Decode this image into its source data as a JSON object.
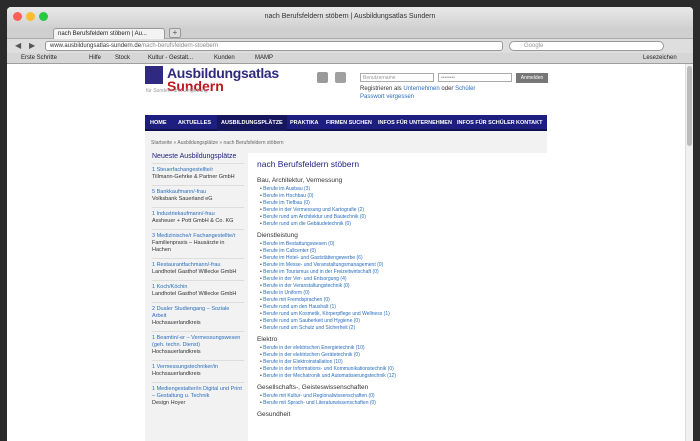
{
  "browser": {
    "window_title": "nach Berufsfeldern stöbern | Ausbildungsatlas Sundern",
    "tab_title": "nach Berufsfeldern stöbern | Au...",
    "url_domain": "www.ausbildungsatlas-sundern.de",
    "url_path": "/nach-berufsfeldern-stoebern",
    "search_placeholder": "Google",
    "bookmarks": [
      "Erste Schritte",
      "Hilfe",
      "Stock",
      "Kultur - Gestalt...",
      "Kunden",
      "MAMP"
    ],
    "reading_list": "Lesezeichen"
  },
  "site": {
    "logo_line1": "Ausbildungsatlas",
    "logo_line2": "Sundern",
    "tagline": "für Sundern und Umgebung",
    "login": {
      "user_placeholder": "Benutzername",
      "pass_placeholder": "••••••••",
      "button": "Anmelden",
      "register_prefix": "Registrieren als",
      "register_company": "Unternehmen",
      "register_or": "oder",
      "register_student": "Schüler",
      "forgot": "Passwort vergessen"
    },
    "nav": [
      "HOME",
      "AKTUELLES",
      "AUSBILDUNGSPLÄTZE",
      "PRAKTIKA",
      "FIRMEN SUCHEN",
      "INFOS FÜR UNTERNEHMEN",
      "INFOS FÜR SCHÜLER",
      "KONTAKT"
    ],
    "breadcrumb": "Startseite » Ausbildungsplätze » nach Berufsfeldern stöbern",
    "sidebar_title": "Neueste Ausbildungsplätze",
    "jobs": [
      {
        "title": "1 Steuerfachangestellte/r",
        "company": "Tillmann-Gehrke & Partner GmbH"
      },
      {
        "title": "5 Bankkaufmann/-frau",
        "company": "Volksbank Sauerland eG"
      },
      {
        "title": "1 Industriekaufmann/-frau",
        "company": "Assheuer + Pott GmbH & Co. KG"
      },
      {
        "title": "3 Medizinische/r Fachangestellte/r",
        "company": "Familienpraxis – Hausärzte in Hachen"
      },
      {
        "title": "1 Restaurantfachmann/-frau",
        "company": "Landhotel Gasthof Willecke GmbH"
      },
      {
        "title": "1 Koch/Köchin",
        "company": "Landhotel Gasthof Willecke GmbH"
      },
      {
        "title": "2 Dualer Studiengang – Soziale Arbeit",
        "company": "Hochsauerlandkreis"
      },
      {
        "title": "1 Beamtin/-er – Vermessungswesen (geh. techn. Dienst)",
        "company": "Hochsauerlandkreis"
      },
      {
        "title": "1 Vermessungstechniker/in",
        "company": "Hochsauerlandkreis"
      },
      {
        "title": "1 Mediengestalter/in Digital und Print – Gestaltung u. Technik",
        "company": "Design Hoyer"
      }
    ],
    "main_title": "nach Berufsfeldern stöbern",
    "categories": [
      {
        "name": "Bau, Architektur, Vermessung",
        "items": [
          "Berufe im Ausbau (3)",
          "Berufe im Hochbau (0)",
          "Berufe im Tiefbau (0)",
          "Berufe in der Vermessung und Kartografie (2)",
          "Berufe rund um Architektur und Bautechnik (0)",
          "Berufe rund um die Gebäudetechnik (0)"
        ]
      },
      {
        "name": "Dienstleistung",
        "items": [
          "Berufe im Bestattungswesen (0)",
          "Berufe im Callcenter (0)",
          "Berufe im Hotel- und Gaststättengewerbe (6)",
          "Berufe im Messe- und Veranstaltungsmanagement (0)",
          "Berufe im Tourismus und in der Freizeitwirtschaft (0)",
          "Berufe in der Ver- und Entsorgung (4)",
          "Berufe in der Veranstaltungstechnik (0)",
          "Berufe in Uniform (0)",
          "Berufe mit Fremdsprachen (0)",
          "Berufe rund um den Haushalt (1)",
          "Berufe rund um Kosmetik, Körperpflege und Wellness (1)",
          "Berufe rund um Sauberkeit und Hygiene (0)",
          "Berufe rund um Schutz und Sicherheit (2)"
        ]
      },
      {
        "name": "Elektro",
        "items": [
          "Berufe in der elektrischen Energietechnik (10)",
          "Berufe in der elektrischen Gerätetechnik (0)",
          "Berufe in der Elektroinstallation (10)",
          "Berufe in der Informations- und Kommunikationstechnik (0)",
          "Berufe in der Mechatronik und Automatisierungstechnik (12)"
        ]
      },
      {
        "name": "Gesellschafts-, Geisteswissenschaften",
        "items": [
          "Berufe mit Kultur- und Regionalwissenschaften (0)",
          "Berufe mit Sprach- und Literaturwissenschaften (0)"
        ]
      },
      {
        "name": "Gesundheit",
        "items": []
      }
    ]
  }
}
